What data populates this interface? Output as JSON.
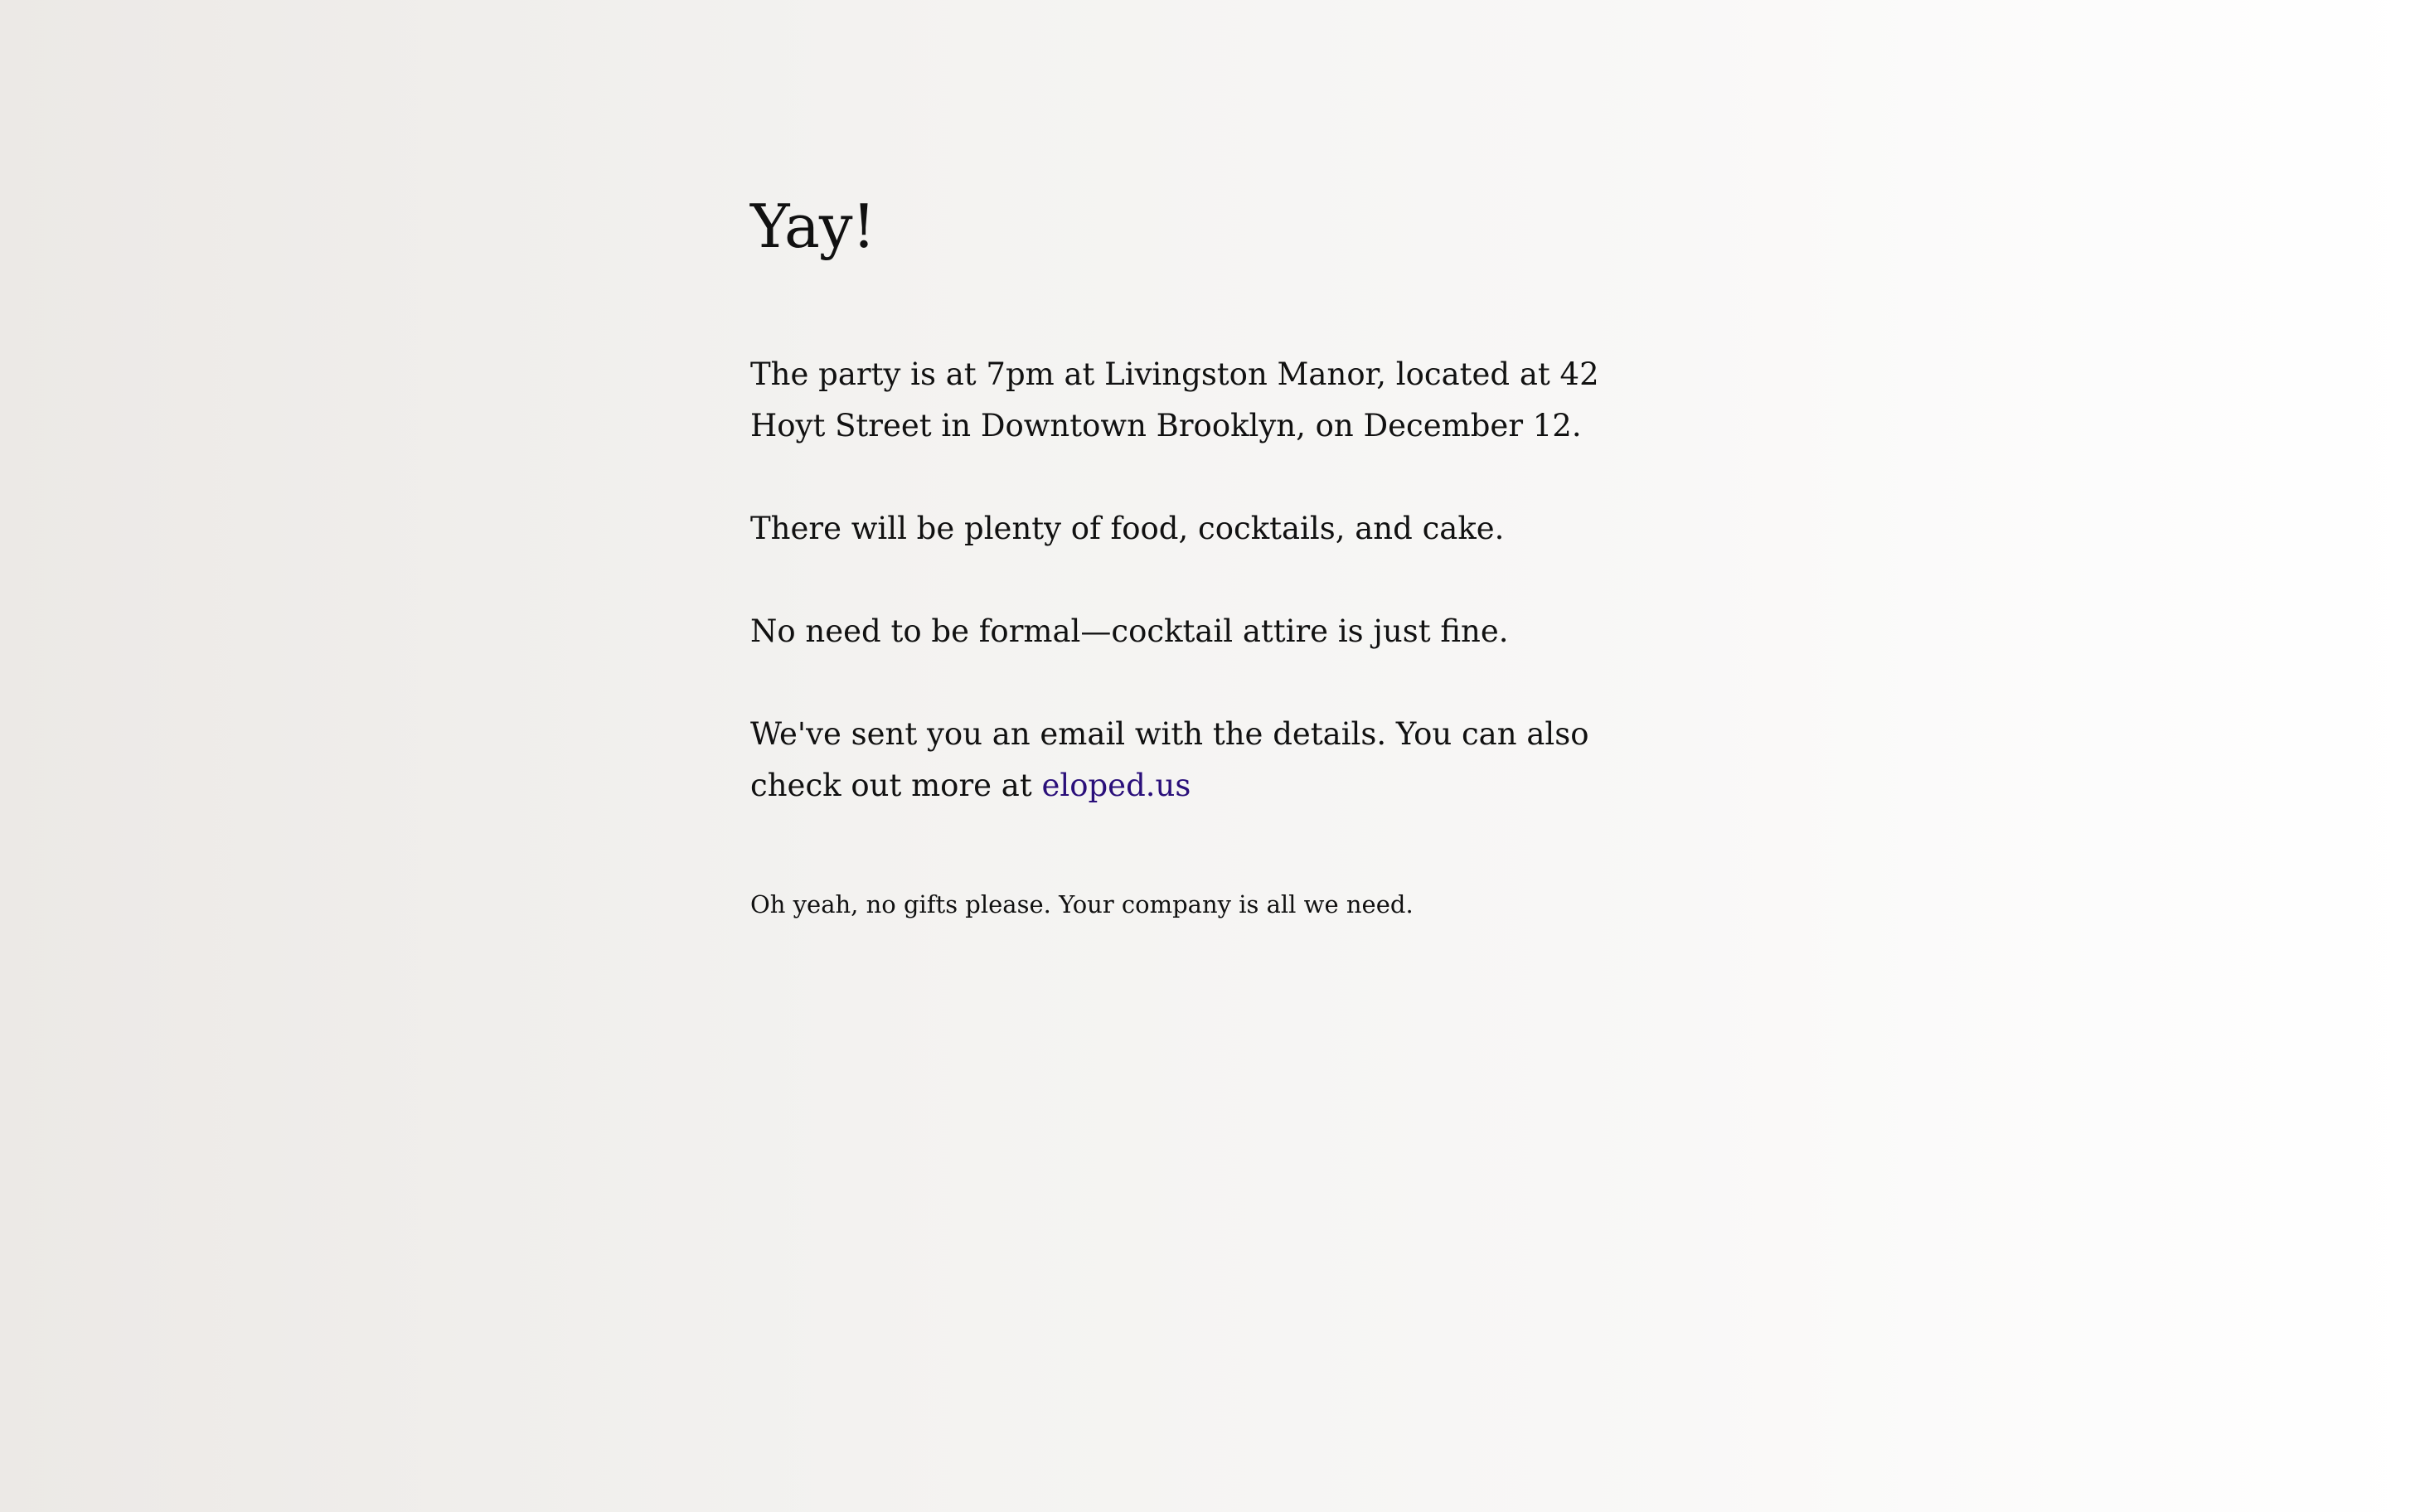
{
  "page": {
    "heading": "Yay!",
    "paragraphs": {
      "location": "The party is at 7pm at Livingston Manor, located at 42 Hoyt Street in Downtown Brooklyn, on December 12.",
      "food": "There will be plenty of food, cocktails, and cake.",
      "attire": "No need to be formal—cocktail attire is just fine.",
      "email_prefix": "We've sent you an email with the details. You can also check out more at ",
      "email_link": "eloped.us"
    },
    "footnote": "Oh yeah, no gifts please. Your company is all we need."
  },
  "colors": {
    "text": "#111111",
    "link": "#2a0f7a",
    "background_left": "#ece9e6",
    "background_right": "#ffffff"
  }
}
